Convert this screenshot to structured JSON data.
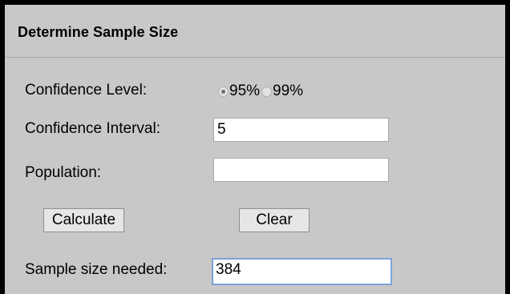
{
  "form": {
    "title": "Determine Sample Size",
    "confidence_level": {
      "label": "Confidence Level:",
      "options": [
        {
          "label": "95%",
          "selected": true
        },
        {
          "label": "99%",
          "selected": false
        }
      ]
    },
    "confidence_interval": {
      "label": "Confidence Interval:",
      "value": "5"
    },
    "population": {
      "label": "Population:",
      "value": ""
    },
    "buttons": {
      "calculate": "Calculate",
      "clear": "Clear"
    },
    "result": {
      "label": "Sample size needed:",
      "value": "384"
    }
  },
  "colors": {
    "panel_background": "#c8c8c8",
    "frame_border": "#000000",
    "focus_border": "#7aa2d8"
  }
}
